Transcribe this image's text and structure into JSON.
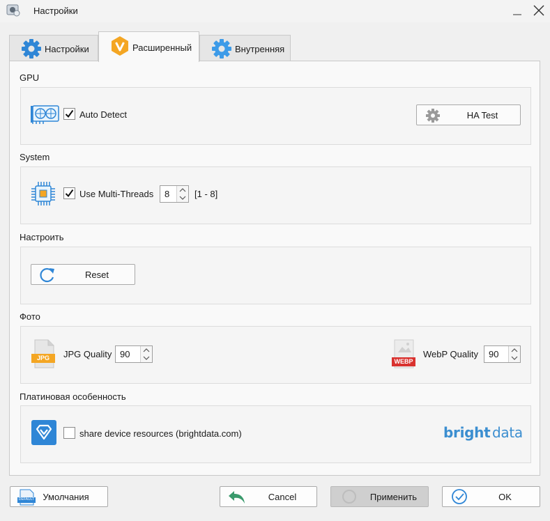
{
  "window": {
    "title": "Настройки"
  },
  "tabs": [
    {
      "label": "Настройки",
      "icon": "gear-icon"
    },
    {
      "label": "Расширенный",
      "icon": "v-hexagon-icon"
    },
    {
      "label": "Внутренняя",
      "icon": "gear-icon"
    }
  ],
  "gpu": {
    "title": "GPU",
    "auto_detect_label": "Auto Detect",
    "auto_detect_checked": true,
    "ha_test_label": "HA Test"
  },
  "system": {
    "title": "System",
    "multithread_label": "Use Multi-Threads",
    "multithread_checked": true,
    "threads_value": "8",
    "threads_range": "[1 - 8]"
  },
  "customize": {
    "title": "Настроить",
    "reset_label": "Reset"
  },
  "photo": {
    "title": "Фото",
    "jpg_icon_text": "JPG",
    "jpg_label": "JPG Quality",
    "jpg_value": "90",
    "webp_icon_text": "WEBP",
    "webp_label": "WebP Quality",
    "webp_value": "90"
  },
  "platinum": {
    "title": "Платиновая особенность",
    "share_label": "share device resources (brightdata.com)",
    "share_checked": false,
    "logo_bright": "bright",
    "logo_data": "data"
  },
  "footer": {
    "defaults_label": "Умолчания",
    "defaults_icon_text": "DEFAULT",
    "cancel_label": "Cancel",
    "apply_label": "Применить",
    "ok_label": "OK"
  },
  "colors": {
    "accent_blue": "#2f86d6",
    "orange": "#f4a623",
    "logo_blue": "#3b8ed0",
    "webp_red": "#d9322f",
    "green_arrow": "#3a9a6c"
  }
}
